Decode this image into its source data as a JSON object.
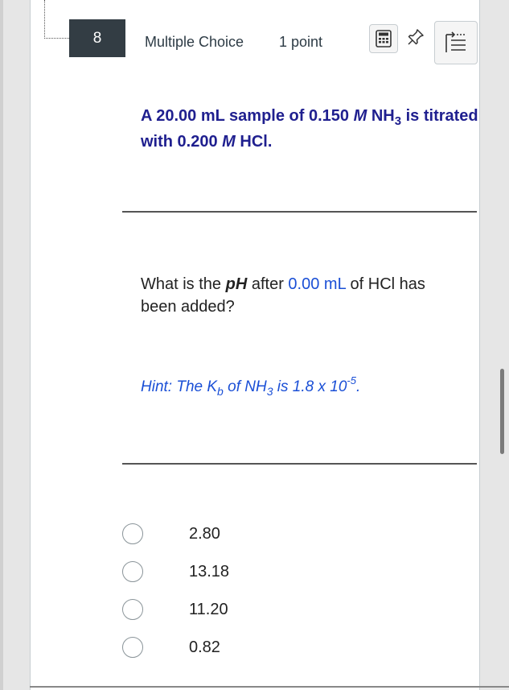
{
  "question": {
    "number": "8",
    "type": "Multiple Choice",
    "points": "1 point",
    "stem_bold_text": "A 20.00 mL sample of 0.150 M NH3 is titrated with 0.200 M HCl.",
    "question_text": "What is the pH after 0.00 mL of HCl has been added?",
    "hint_text": "Hint: The Kb of NH3 is 1.8 x 10-5.",
    "options": [
      {
        "label": "2.80",
        "selected": false
      },
      {
        "label": "13.18",
        "selected": false
      },
      {
        "label": "11.20",
        "selected": false
      },
      {
        "label": "0.82",
        "selected": false
      }
    ]
  },
  "toolbar": {
    "icons": [
      "calculator-icon",
      "pin-icon",
      "outline-icon"
    ]
  },
  "colors": {
    "stem": "#1f1f8f",
    "accent": "#1a4fd6",
    "badge_bg": "#333d44"
  }
}
